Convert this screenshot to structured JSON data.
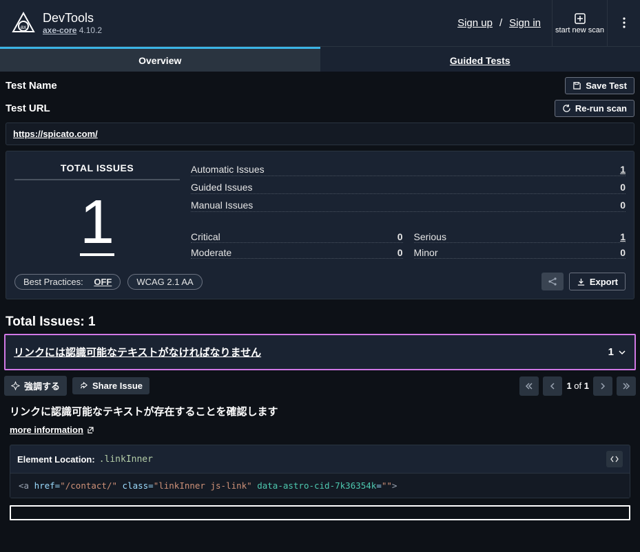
{
  "header": {
    "product_name": "DevTools",
    "core_label": "axe-core",
    "version": "4.10.2",
    "signup": "Sign up",
    "signin": "Sign in",
    "start_scan": "start new scan"
  },
  "tabs": {
    "overview": "Overview",
    "guided": "Guided Tests"
  },
  "test_name_label": "Test Name",
  "save_test_label": "Save Test",
  "test_url_label": "Test URL",
  "rerun_label": "Re-run scan",
  "test_url": "https://spicato.com/",
  "summary": {
    "total_label": "TOTAL ISSUES",
    "total_count": "1",
    "rows": [
      {
        "name": "Automatic Issues",
        "value": "1",
        "hl": true
      },
      {
        "name": "Guided Issues",
        "value": "0",
        "hl": false
      },
      {
        "name": "Manual Issues",
        "value": "0",
        "hl": false
      }
    ],
    "severities": [
      {
        "name": "Critical",
        "value": "0",
        "hl": false
      },
      {
        "name": "Serious",
        "value": "1",
        "hl": true
      },
      {
        "name": "Moderate",
        "value": "0",
        "hl": false
      },
      {
        "name": "Minor",
        "value": "0",
        "hl": false
      }
    ],
    "best_practices_label": "Best Practices:",
    "best_practices_value": "OFF",
    "wcag_label": "WCAG 2.1 AA",
    "export_label": "Export"
  },
  "issues_header": "Total Issues: 1",
  "issue": {
    "title": "リンクには認識可能なテキストがなければなりません",
    "count": "1"
  },
  "actions": {
    "highlight": "強調する",
    "share": "Share Issue"
  },
  "pager": {
    "current": "1",
    "sep": "of",
    "total": "1"
  },
  "detail": {
    "description": "リンクに認識可能なテキストが存在することを確認します",
    "more_info": "more information",
    "element_location_label": "Element Location:",
    "selector": ".linkInner",
    "code": {
      "open": "<a ",
      "href_attr": "href=",
      "href_val": "\"/contact/\"",
      "class_attr": " class=",
      "class_val": "\"linkInner js-link\"",
      "cid_attr": " data-astro-cid-7k36354k",
      "eq": "=",
      "cid_val": "\"\"",
      "close": ">"
    }
  }
}
